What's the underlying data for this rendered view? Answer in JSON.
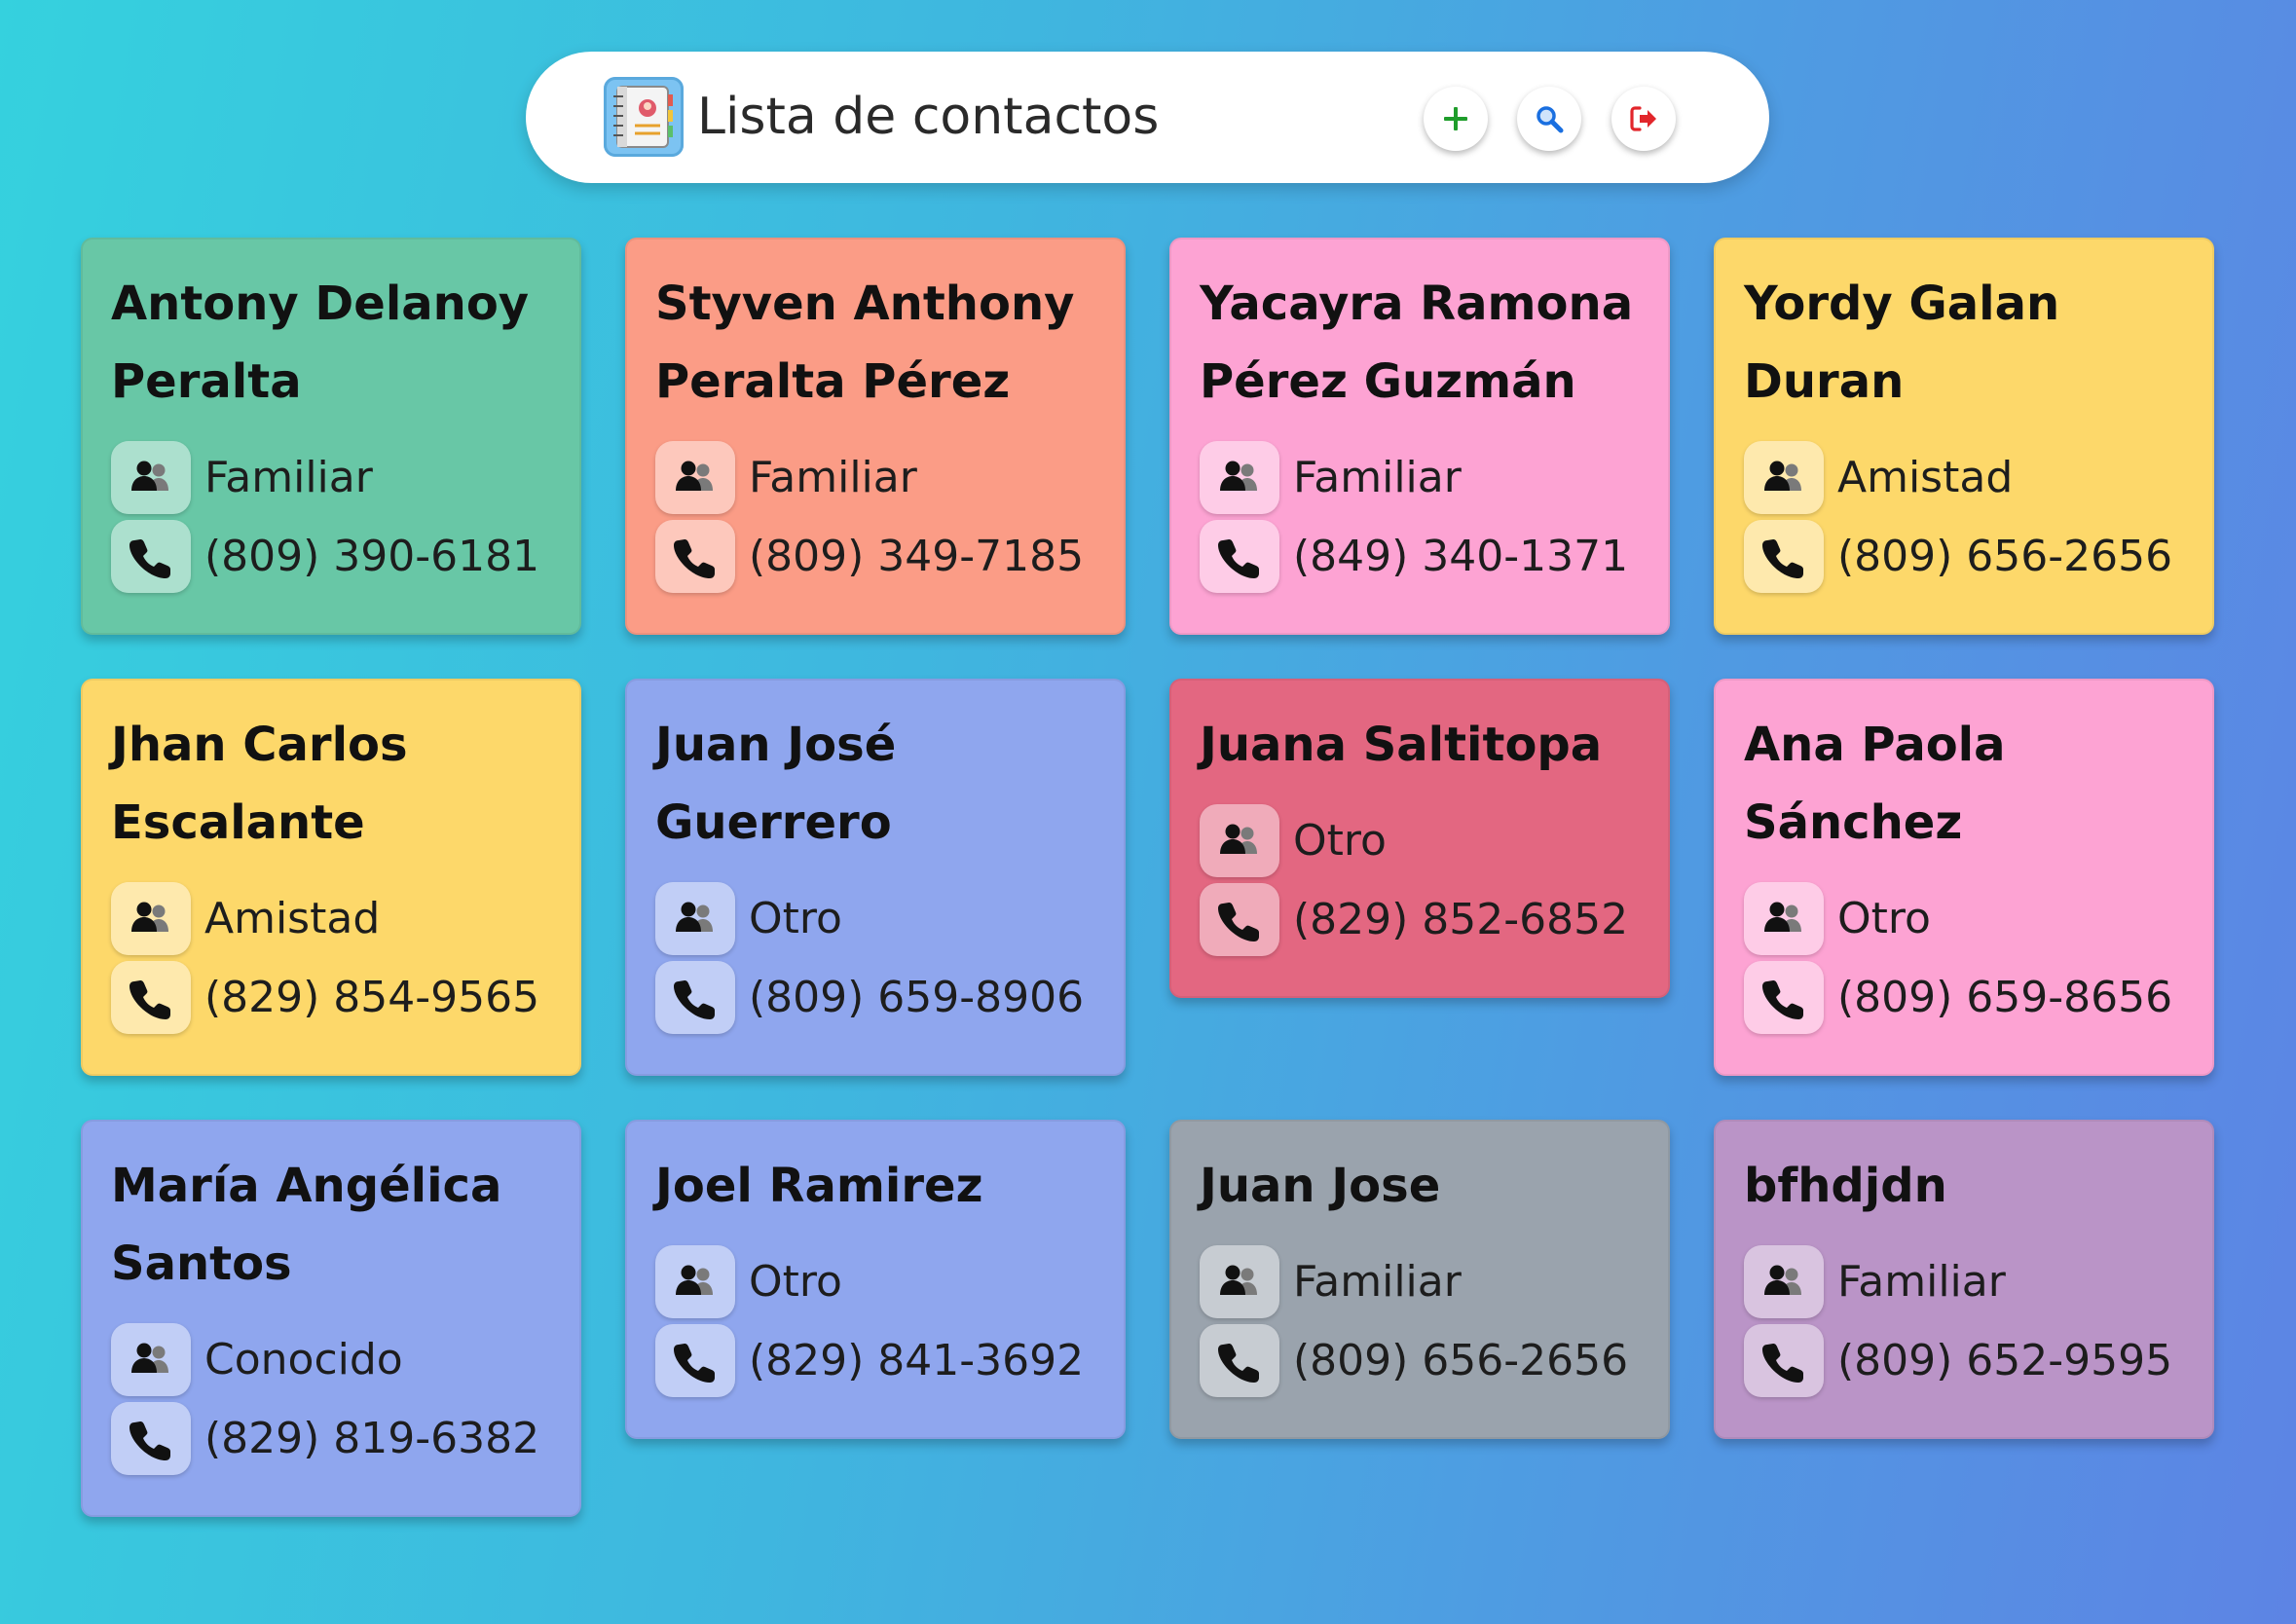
{
  "header": {
    "title": "Lista de contactos",
    "icon": "contacts-book-icon",
    "buttons": [
      {
        "name": "add-contact-button",
        "icon": "plus-icon",
        "color": "#1f9d2b"
      },
      {
        "name": "search-button",
        "icon": "search-icon",
        "color": "#1a6fe0"
      },
      {
        "name": "logout-button",
        "icon": "sign-out-icon",
        "color": "#e2262b"
      }
    ]
  },
  "contacts": [
    {
      "name": "Antony Delanoy Peralta",
      "relation": "Familiar",
      "phone": "(809) 390-6181",
      "color": "#68c7a6"
    },
    {
      "name": "Styven Anthony Peralta Pérez",
      "relation": "Familiar",
      "phone": "(809) 349-7185",
      "color": "#fb9c86"
    },
    {
      "name": "Yacayra Ramona Pérez Guzmán",
      "relation": "Familiar",
      "phone": "(849) 340-1371",
      "color": "#fda3d3"
    },
    {
      "name": "Yordy Galan Duran",
      "relation": "Amistad",
      "phone": "(809) 656-2656",
      "color": "#fdd86a"
    },
    {
      "name": "Jhan Carlos Escalante",
      "relation": "Amistad",
      "phone": "(829) 854-9565",
      "color": "#fdd86a"
    },
    {
      "name": "Juan José Guerrero",
      "relation": "Otro",
      "phone": "(809) 659-8906",
      "color": "#8fa6ee"
    },
    {
      "name": "Juana Saltitopa",
      "relation": "Otro",
      "phone": "(829) 852-6852",
      "color": "#e36781"
    },
    {
      "name": "Ana Paola Sánchez",
      "relation": "Otro",
      "phone": "(809) 659-8656",
      "color": "#fda3d3"
    },
    {
      "name": "María Angélica Santos",
      "relation": "Conocido",
      "phone": "(829) 819-6382",
      "color": "#8fa6ee"
    },
    {
      "name": "Joel Ramirez",
      "relation": "Otro",
      "phone": "(829) 841-3692",
      "color": "#8fa6ee"
    },
    {
      "name": "Juan Jose",
      "relation": "Familiar",
      "phone": "(809) 656-2656",
      "color": "#9aa3ad"
    },
    {
      "name": "bfhdjdn",
      "relation": "Familiar",
      "phone": "(809) 652-9595",
      "color": "#ba94c7"
    }
  ],
  "colors": {
    "background_start": "#35d1de",
    "background_end": "#5d84e4",
    "header_bg": "#ffffff"
  }
}
